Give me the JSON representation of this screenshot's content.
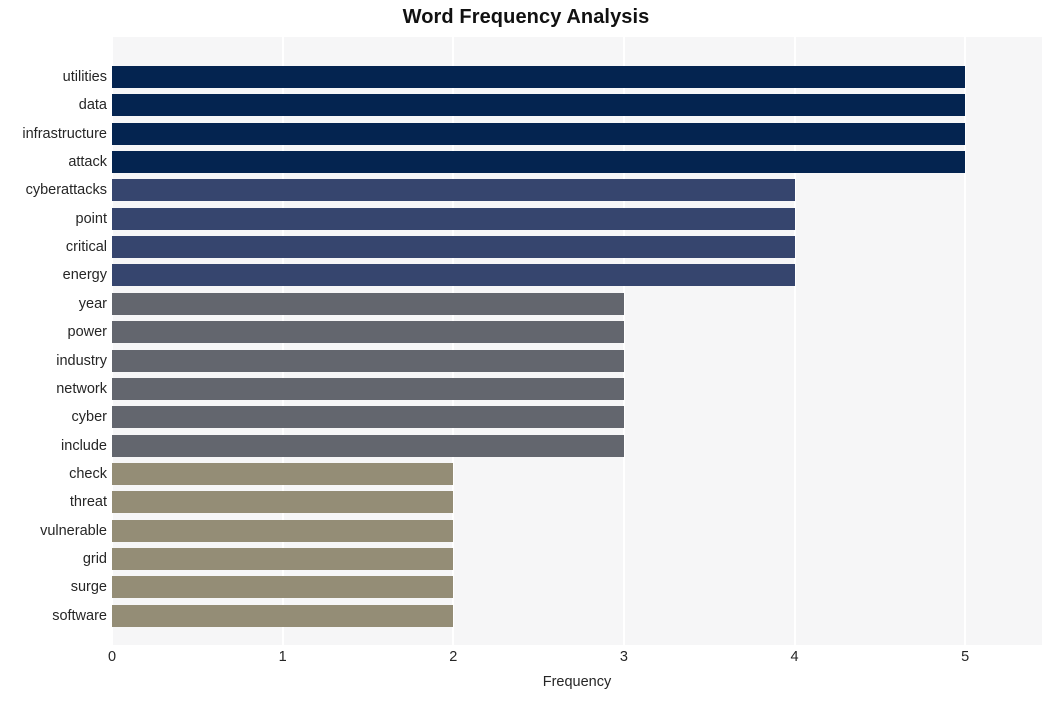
{
  "chart_data": {
    "type": "bar",
    "orientation": "horizontal",
    "title": "Word Frequency Analysis",
    "xlabel": "Frequency",
    "ylabel": "",
    "xlim": [
      0,
      5.45
    ],
    "xticks": [
      0,
      1,
      2,
      3,
      4,
      5
    ],
    "xtick_labels": [
      "0",
      "1",
      "2",
      "3",
      "4",
      "5"
    ],
    "grid": "vertical-white-on-light",
    "legend": "none",
    "categories": [
      "utilities",
      "data",
      "infrastructure",
      "attack",
      "cyberattacks",
      "point",
      "critical",
      "energy",
      "year",
      "power",
      "industry",
      "network",
      "cyber",
      "include",
      "check",
      "threat",
      "vulnerable",
      "grid",
      "surge",
      "software"
    ],
    "values": [
      5,
      5,
      5,
      5,
      4,
      4,
      4,
      4,
      3,
      3,
      3,
      3,
      3,
      3,
      2,
      2,
      2,
      2,
      2,
      2
    ],
    "bar_colors": [
      "#042450",
      "#042450",
      "#042450",
      "#042450",
      "#36456e",
      "#36456e",
      "#36456e",
      "#36456e",
      "#63666e",
      "#63666e",
      "#63666e",
      "#63666e",
      "#63666e",
      "#63666e",
      "#948d76",
      "#948d76",
      "#948d76",
      "#948d76",
      "#948d76",
      "#948d76"
    ],
    "palette": {
      "freq_5": "#042450",
      "freq_4": "#36456e",
      "freq_3": "#63666e",
      "freq_2": "#948d76"
    },
    "plot_background": "#f6f6f7",
    "figure_background": "#ffffff",
    "gridline_color": "#ffffff",
    "text_color": "#262626"
  }
}
